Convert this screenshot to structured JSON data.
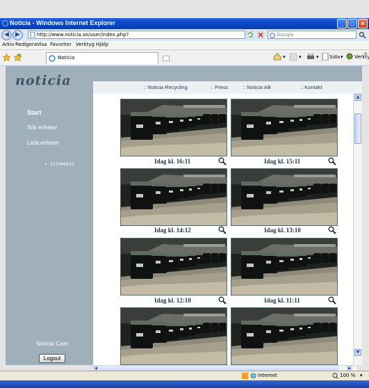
{
  "window": {
    "title": "Noticia - Windows Internet Explorer"
  },
  "addressbar": {
    "url": "http://www.noticia.se/user/index.php?",
    "search_placeholder": "Google"
  },
  "menubar": {
    "items": [
      "Arkiv",
      "Redigera",
      "Visa",
      "Favoriter",
      "Verktyg",
      "Hjälp"
    ]
  },
  "tabbar": {
    "tab_label": "Noticia",
    "page_label": "Sida",
    "tools_label": "Verktyg",
    "overflow": "»"
  },
  "site": {
    "logo": "noticia",
    "nav": [
      ":: Noticia Recycling",
      ":: Press",
      ":: Noticia AB",
      ":: Kontakt"
    ],
    "sidebar": {
      "start": "Start",
      "search_units": "Sök enheter",
      "list_units": "Lista enheter",
      "unit_id": "117440515",
      "cam_label": "Noticia Cam",
      "logout": "Logout"
    }
  },
  "gallery": {
    "captions": [
      "Idag kl. 16:11",
      "Idag kl. 15:11",
      "Idag kl. 14:12",
      "Idag kl. 13:10",
      "Idag kl. 12:10",
      "Idag kl. 11:11"
    ]
  },
  "statusbar": {
    "zone": "Internet",
    "zoom": "100 %"
  },
  "colors": {
    "sidebar": "#9fb0bb",
    "titlebar": "#0b48c8",
    "caption": "#1d3145"
  }
}
